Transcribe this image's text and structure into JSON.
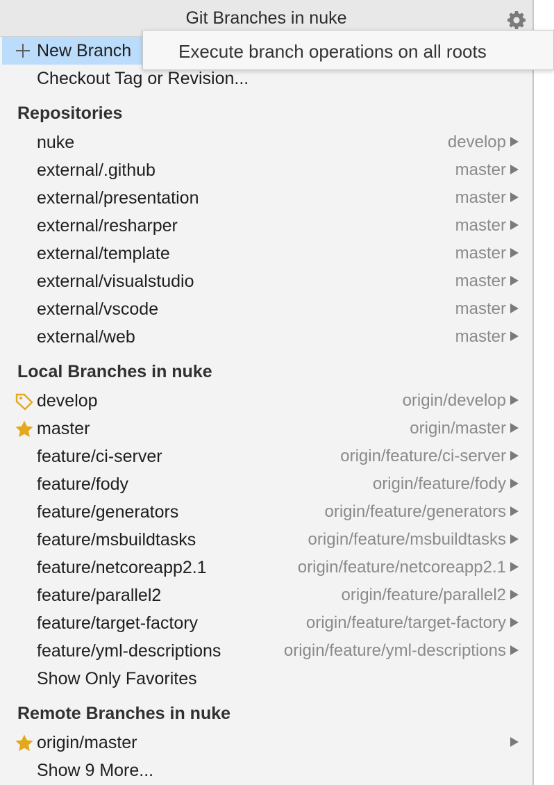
{
  "popup": {
    "title": "Git Branches in nuke",
    "settings_icon": "gear-icon",
    "tooltip": "Execute branch operations on all roots"
  },
  "actions": {
    "new_branch": "New Branch",
    "checkout": "Checkout Tag or Revision..."
  },
  "repositories": {
    "header": "Repositories",
    "items": [
      {
        "name": "nuke",
        "branch": "develop"
      },
      {
        "name": "external/.github",
        "branch": "master"
      },
      {
        "name": "external/presentation",
        "branch": "master"
      },
      {
        "name": "external/resharper",
        "branch": "master"
      },
      {
        "name": "external/template",
        "branch": "master"
      },
      {
        "name": "external/visualstudio",
        "branch": "master"
      },
      {
        "name": "external/vscode",
        "branch": "master"
      },
      {
        "name": "external/web",
        "branch": "master"
      }
    ]
  },
  "local_branches": {
    "header": "Local Branches in nuke",
    "items": [
      {
        "name": "develop",
        "tracking": "origin/develop",
        "icon": "tag-icon"
      },
      {
        "name": "master",
        "tracking": "origin/master",
        "icon": "star-icon"
      },
      {
        "name": "feature/ci-server",
        "tracking": "origin/feature/ci-server"
      },
      {
        "name": "feature/fody",
        "tracking": "origin/feature/fody"
      },
      {
        "name": "feature/generators",
        "tracking": "origin/feature/generators"
      },
      {
        "name": "feature/msbuildtasks",
        "tracking": "origin/feature/msbuildtasks"
      },
      {
        "name": "feature/netcoreapp2.1",
        "tracking": "origin/feature/netcoreapp2.1"
      },
      {
        "name": "feature/parallel2",
        "tracking": "origin/feature/parallel2"
      },
      {
        "name": "feature/target-factory",
        "tracking": "origin/feature/target-factory"
      },
      {
        "name": "feature/yml-descriptions",
        "tracking": "origin/feature/yml-descriptions"
      }
    ],
    "show_only_favorites": "Show Only Favorites"
  },
  "remote_branches": {
    "header": "Remote Branches in nuke",
    "items": [
      {
        "name": "origin/master",
        "icon": "star-icon"
      }
    ],
    "show_more": "Show 9 More..."
  },
  "colors": {
    "selection": "#bcdcfb",
    "star": "#e3a81c",
    "tag": "#e3a81c",
    "secondary_text": "#8a8a8a"
  }
}
